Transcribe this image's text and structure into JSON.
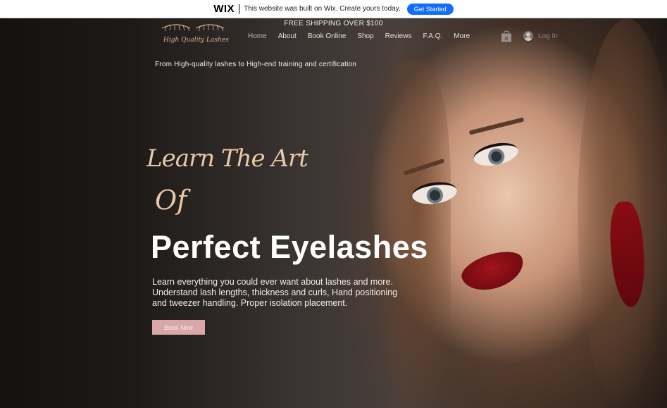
{
  "wix_banner": {
    "logo": "WIX",
    "text": "This website was built on Wix. Create yours today.",
    "button": "Get Started"
  },
  "header": {
    "shipping": "FREE SHIPPING OVER $100",
    "logo_text": "High Quality Lashes",
    "nav": [
      "Home",
      "About",
      "Book Online",
      "Shop",
      "Reviews",
      "F.A.Q.",
      "More"
    ],
    "cart_count": "0",
    "login": "Log In",
    "tagline": "From High-quality lashes to High-end training and certification"
  },
  "hero": {
    "script_line1": "Learn The Art",
    "script_line2": "Of",
    "headline": "Perfect Eyelashes",
    "description_lines": [
      "Learn everything you could ever want about lashes and more.",
      "Understand lash lengths, thickness and curls, Hand positioning",
      "and tweezer handling. Proper isolation placement."
    ],
    "cta": "Book Now"
  },
  "colors": {
    "wix_blue": "#116dff",
    "cta_pink": "#d8a7a6",
    "script_gold": "#e7c9a8",
    "lip_red": "#a4141c"
  }
}
